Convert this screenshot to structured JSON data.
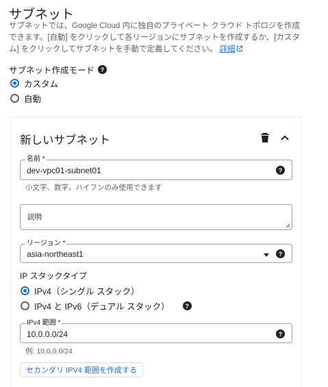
{
  "header": {
    "title": "サブネット",
    "description": "サブネットでは、Google Cloud 内に独自のプライベート クラウド トポロジを作成できます。[自動] をクリックして各リージョンにサブネットを作成するか、[カスタム] をクリックしてサブネットを手動で定義してください。",
    "link": "詳細"
  },
  "mode": {
    "label": "サブネット作成モード",
    "options": [
      {
        "label": "カスタム",
        "selected": true
      },
      {
        "label": "自動",
        "selected": false
      }
    ]
  },
  "subnet": {
    "title": "新しいサブネット",
    "name": {
      "label": "名前 *",
      "value": "dev-vpc01-subnet01",
      "hint": "小文字、数字、ハイフンのみ使用できます"
    },
    "description": {
      "label": "説明",
      "value": ""
    },
    "region": {
      "label": "リージョン *",
      "value": "asia-northeast1"
    },
    "ip_stack": {
      "label": "IP スタックタイプ",
      "options": [
        {
          "label": "IPv4（シングル スタック）",
          "selected": true
        },
        {
          "label": "IPv4 と IPv6（デュアル スタック）",
          "selected": false
        }
      ]
    },
    "ipv4_range": {
      "label": "IPv4 範囲 *",
      "value": "10.0.0.0/24",
      "hint": "例: 10.0.0.0/24"
    },
    "secondary_button": "セカンダリ IPV4 範囲を作成する"
  },
  "colors": {
    "accent": "#1a73e8",
    "text": "#202124",
    "muted": "#5f6368"
  }
}
